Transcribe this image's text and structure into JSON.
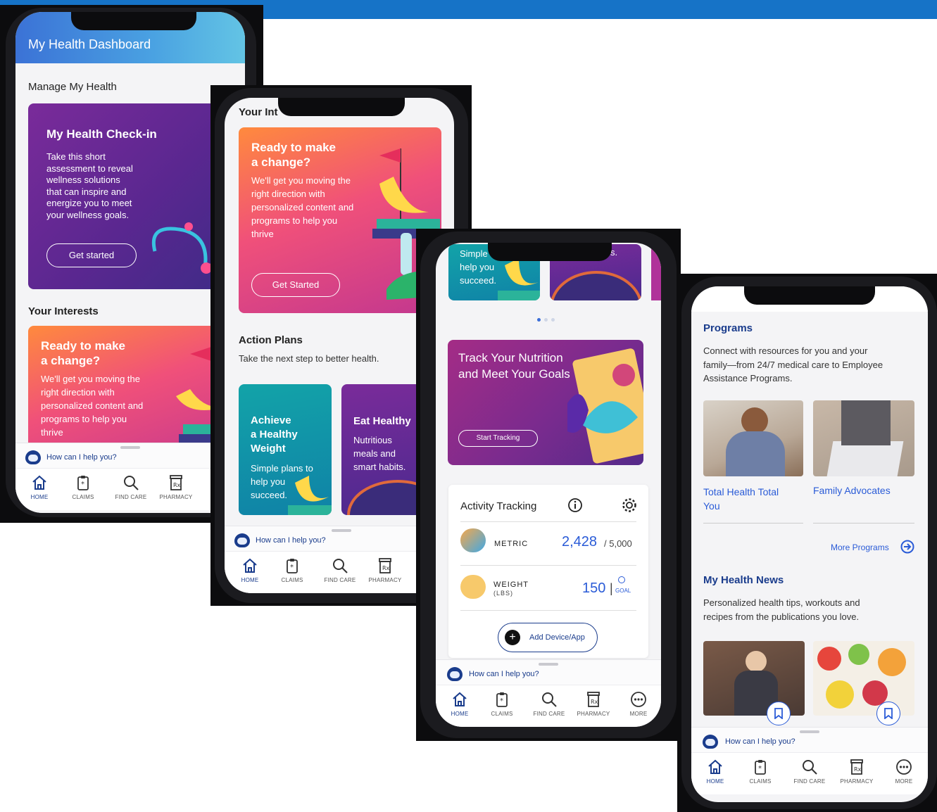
{
  "colors": {
    "brand_blue": "#1a3c8c",
    "link_blue": "#2a5bd7",
    "top_bar": "#1673c7"
  },
  "screen1": {
    "header_title": "My Health Dashboard",
    "section_title": "Manage My Health",
    "checkin": {
      "title": "My Health Check-in",
      "body_lines": [
        "Take this short",
        "assessment to reveal",
        "wellness solutions",
        "that can inspire and",
        "energize you to meet",
        "your wellness goals."
      ],
      "button": "Get started"
    },
    "interests_title": "Your Interests",
    "change_card": {
      "title_lines": [
        "Ready to make",
        "a change?"
      ],
      "body_lines": [
        "We'll get you moving the",
        "right direction with",
        "personalized content and",
        "programs to help you",
        "thrive"
      ]
    }
  },
  "screen2": {
    "header_partial": "Your Int",
    "change_card": {
      "title_lines": [
        "Ready to make",
        "a change?"
      ],
      "body_lines": [
        "We'll get you moving the",
        "right direction with",
        "personalized content and",
        "programs to help you",
        "thrive"
      ],
      "button": "Get Started"
    },
    "action_plans_title": "Action Plans",
    "action_plans_subtitle": "Take the next step to better health.",
    "plan_weight": {
      "title_lines": [
        "Achieve",
        "a Healthy",
        "Weight"
      ],
      "body_lines": [
        "Simple plans to",
        "help you",
        "succeed."
      ]
    },
    "plan_eat": {
      "title": "Eat Healthy",
      "body_lines": [
        "Nutritious",
        "meals and",
        "smart habits."
      ]
    }
  },
  "screen3": {
    "top_card_lines": [
      "Simple",
      "help you",
      "succeed."
    ],
    "top_card_partial": "s.",
    "nutrition": {
      "title_lines": [
        "Track Your Nutrition",
        "and Meet Your Goals"
      ],
      "button": "Start Tracking"
    },
    "activity": {
      "title": "Activity Tracking",
      "metric_label": "METRIC",
      "metric_value": "2,428",
      "metric_goal": "/ 5,000",
      "weight_label": "WEIGHT",
      "weight_unit": "(LBS)",
      "weight_value": "150",
      "weight_goal": "GOAL",
      "add_button": "Add Device/App"
    }
  },
  "screen4": {
    "programs_title": "Programs",
    "programs_desc_lines": [
      "Connect with resources for you and your",
      "family—from 24/7 medical care to Employee",
      "Assistance Programs."
    ],
    "program_1_lines": [
      "Total Health Total",
      "You"
    ],
    "program_2": "Family Advocates",
    "more_programs": "More Programs",
    "news_title": "My Health News",
    "news_desc_lines": [
      "Personalized health tips, workouts and",
      "recipes from the publications you love."
    ]
  },
  "assistant": "How can I help you?",
  "tabs": {
    "home": "HOME",
    "claims": "CLAIMS",
    "find_care": "FIND CARE",
    "pharmacy": "PHARMACY",
    "more": "MORE"
  }
}
